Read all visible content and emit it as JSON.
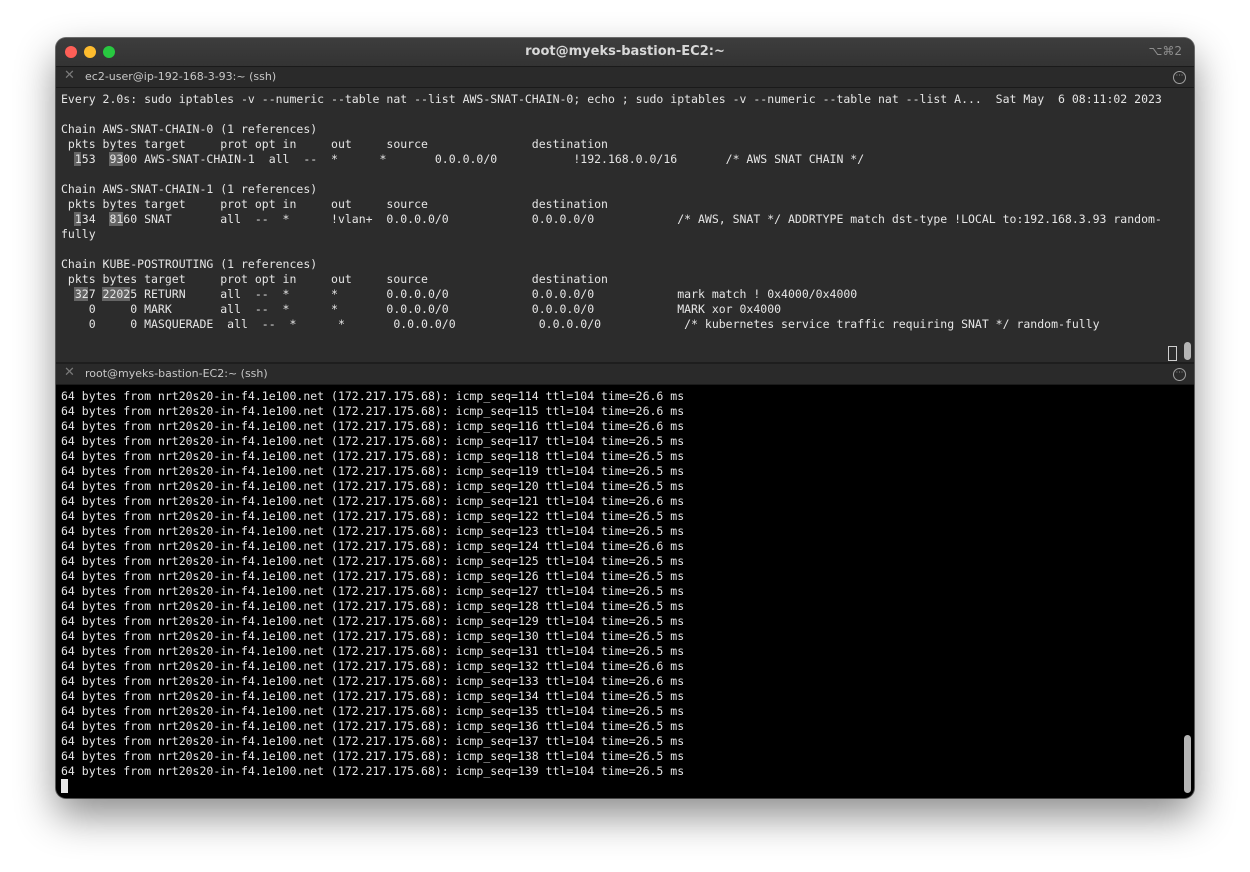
{
  "window": {
    "title": "root@myeks-bastion-EC2:~",
    "shortcut": "⌥⌘2"
  },
  "pane1": {
    "tab_title": "ec2-user@ip-192-168-3-93:~ (ssh)",
    "lines": [
      "Every 2.0s: sudo iptables -v --numeric --table nat --list AWS-SNAT-CHAIN-0; echo ; sudo iptables -v --numeric --table nat --list A...  Sat May  6 08:11:02 2023",
      "",
      "Chain AWS-SNAT-CHAIN-0 (1 references)",
      " pkts bytes target     prot opt in     out     source               destination",
      "  153  9300 AWS-SNAT-CHAIN-1  all  --  *      *       0.0.0.0/0           !192.168.0.0/16       /* AWS SNAT CHAIN */",
      "",
      "Chain AWS-SNAT-CHAIN-1 (1 references)",
      " pkts bytes target     prot opt in     out     source               destination",
      "  134  8160 SNAT       all  --  *      !vlan+  0.0.0.0/0            0.0.0.0/0            /* AWS, SNAT */ ADDRTYPE match dst-type !LOCAL to:192.168.3.93 random-",
      "fully",
      "",
      "Chain KUBE-POSTROUTING (1 references)",
      " pkts bytes target     prot opt in     out     source               destination",
      "  327 22025 RETURN     all  --  *      *       0.0.0.0/0            0.0.0.0/0            mark match ! 0x4000/0x4000",
      "    0     0 MARK       all  --  *      *       0.0.0.0/0            0.0.0.0/0            MARK xor 0x4000",
      "    0     0 MASQUERADE  all  --  *      *       0.0.0.0/0            0.0.0.0/0            /* kubernetes service traffic requiring SNAT */ random-fully"
    ]
  },
  "pane2": {
    "tab_title": "root@myeks-bastion-EC2:~ (ssh)",
    "lines": [
      "64 bytes from nrt20s20-in-f4.1e100.net (172.217.175.68): icmp_seq=114 ttl=104 time=26.6 ms",
      "64 bytes from nrt20s20-in-f4.1e100.net (172.217.175.68): icmp_seq=115 ttl=104 time=26.6 ms",
      "64 bytes from nrt20s20-in-f4.1e100.net (172.217.175.68): icmp_seq=116 ttl=104 time=26.6 ms",
      "64 bytes from nrt20s20-in-f4.1e100.net (172.217.175.68): icmp_seq=117 ttl=104 time=26.5 ms",
      "64 bytes from nrt20s20-in-f4.1e100.net (172.217.175.68): icmp_seq=118 ttl=104 time=26.5 ms",
      "64 bytes from nrt20s20-in-f4.1e100.net (172.217.175.68): icmp_seq=119 ttl=104 time=26.5 ms",
      "64 bytes from nrt20s20-in-f4.1e100.net (172.217.175.68): icmp_seq=120 ttl=104 time=26.5 ms",
      "64 bytes from nrt20s20-in-f4.1e100.net (172.217.175.68): icmp_seq=121 ttl=104 time=26.6 ms",
      "64 bytes from nrt20s20-in-f4.1e100.net (172.217.175.68): icmp_seq=122 ttl=104 time=26.5 ms",
      "64 bytes from nrt20s20-in-f4.1e100.net (172.217.175.68): icmp_seq=123 ttl=104 time=26.5 ms",
      "64 bytes from nrt20s20-in-f4.1e100.net (172.217.175.68): icmp_seq=124 ttl=104 time=26.6 ms",
      "64 bytes from nrt20s20-in-f4.1e100.net (172.217.175.68): icmp_seq=125 ttl=104 time=26.5 ms",
      "64 bytes from nrt20s20-in-f4.1e100.net (172.217.175.68): icmp_seq=126 ttl=104 time=26.5 ms",
      "64 bytes from nrt20s20-in-f4.1e100.net (172.217.175.68): icmp_seq=127 ttl=104 time=26.5 ms",
      "64 bytes from nrt20s20-in-f4.1e100.net (172.217.175.68): icmp_seq=128 ttl=104 time=26.5 ms",
      "64 bytes from nrt20s20-in-f4.1e100.net (172.217.175.68): icmp_seq=129 ttl=104 time=26.5 ms",
      "64 bytes from nrt20s20-in-f4.1e100.net (172.217.175.68): icmp_seq=130 ttl=104 time=26.5 ms",
      "64 bytes from nrt20s20-in-f4.1e100.net (172.217.175.68): icmp_seq=131 ttl=104 time=26.5 ms",
      "64 bytes from nrt20s20-in-f4.1e100.net (172.217.175.68): icmp_seq=132 ttl=104 time=26.6 ms",
      "64 bytes from nrt20s20-in-f4.1e100.net (172.217.175.68): icmp_seq=133 ttl=104 time=26.6 ms",
      "64 bytes from nrt20s20-in-f4.1e100.net (172.217.175.68): icmp_seq=134 ttl=104 time=26.5 ms",
      "64 bytes from nrt20s20-in-f4.1e100.net (172.217.175.68): icmp_seq=135 ttl=104 time=26.5 ms",
      "64 bytes from nrt20s20-in-f4.1e100.net (172.217.175.68): icmp_seq=136 ttl=104 time=26.5 ms",
      "64 bytes from nrt20s20-in-f4.1e100.net (172.217.175.68): icmp_seq=137 ttl=104 time=26.5 ms",
      "64 bytes from nrt20s20-in-f4.1e100.net (172.217.175.68): icmp_seq=138 ttl=104 time=26.5 ms",
      "64 bytes from nrt20s20-in-f4.1e100.net (172.217.175.68): icmp_seq=139 ttl=104 time=26.5 ms"
    ]
  }
}
